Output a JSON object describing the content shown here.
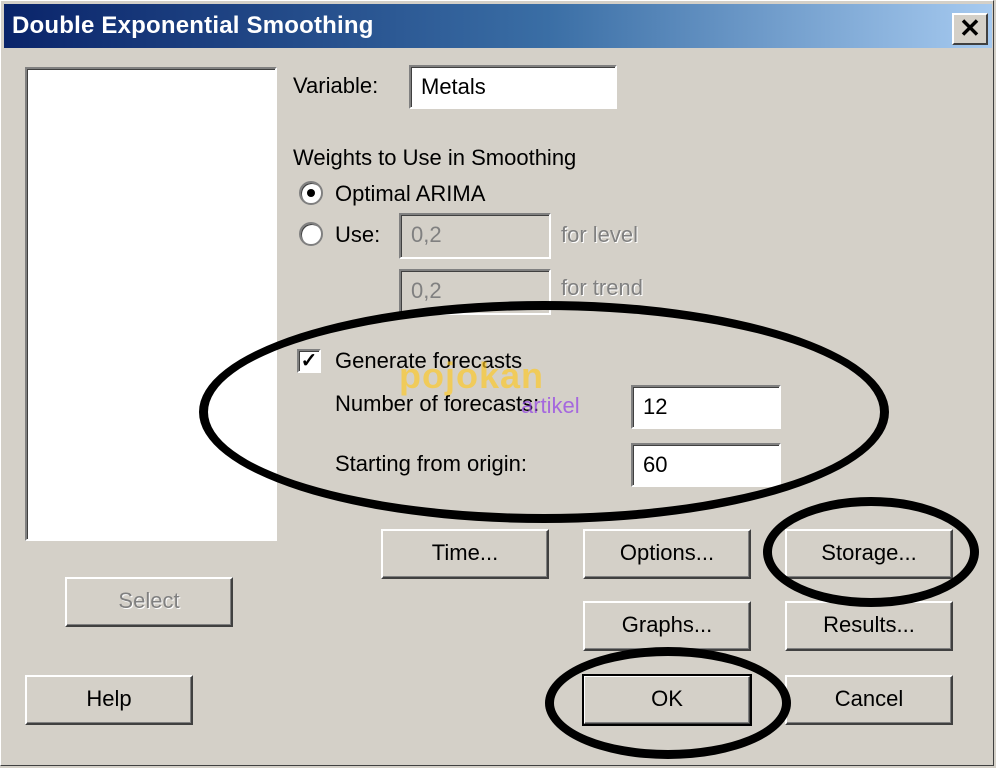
{
  "window": {
    "title": "Double Exponential Smoothing",
    "close_glyph": "✕"
  },
  "variable": {
    "label": "Variable:",
    "value": "Metals"
  },
  "weights": {
    "heading": "Weights to Use in Smoothing",
    "optimal_label": "Optimal ARIMA",
    "optimal_selected": true,
    "use_label": "Use:",
    "level_value": "0,2",
    "level_label": "for level",
    "trend_value": "0,2",
    "trend_label": "for trend"
  },
  "forecasts": {
    "generate_label": "Generate forecasts",
    "generate_checked": true,
    "check_glyph": "✓",
    "number_label": "Number of forecasts:",
    "number_value": "12",
    "origin_label": "Starting from origin:",
    "origin_value": "60"
  },
  "buttons": {
    "select": "Select",
    "time": "Time...",
    "options": "Options...",
    "storage": "Storage...",
    "graphs": "Graphs...",
    "results": "Results...",
    "help": "Help",
    "ok": "OK",
    "cancel": "Cancel"
  },
  "watermark": {
    "main": "pojokan",
    "sub": "artikel"
  },
  "colors": {
    "title_start": "#0a246a",
    "title_end": "#a6caf0",
    "dialog_bg": "#d4d0c8",
    "annotation": "#000000"
  }
}
